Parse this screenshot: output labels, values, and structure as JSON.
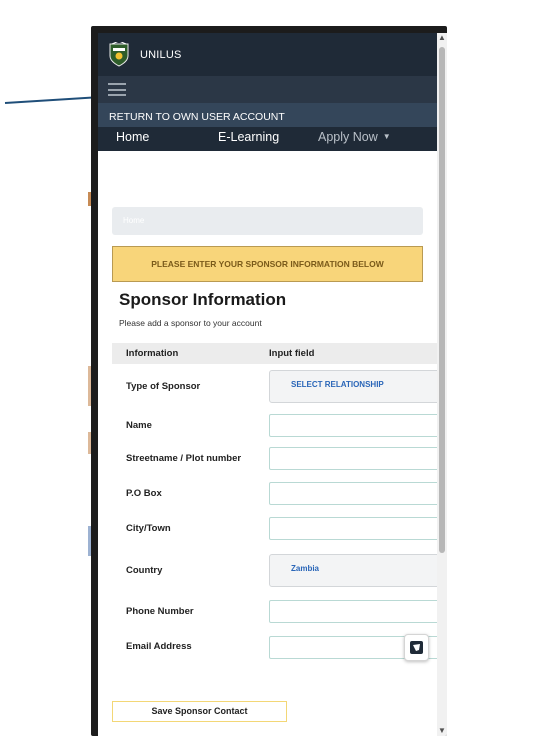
{
  "app": {
    "name": "UNILUS"
  },
  "nav": {
    "return_label": "RETURN TO OWN USER ACCOUNT",
    "links": [
      "Home",
      "E-Learning",
      "Apply Now"
    ]
  },
  "breadcrumb": "Home",
  "alert": "PLEASE ENTER YOUR SPONSOR INFORMATION BELOW",
  "form": {
    "title": "Sponsor Information",
    "subtitle": "Please add a sponsor to your account",
    "headers": [
      "Information",
      "Input field"
    ],
    "rows": {
      "sponsor_type": {
        "label": "Type of Sponsor",
        "value": "SELECT RELATIONSHIP"
      },
      "name": {
        "label": "Name",
        "value": ""
      },
      "street": {
        "label": "Streetname / Plot number",
        "value": ""
      },
      "po_box": {
        "label": "P.O Box",
        "value": ""
      },
      "city": {
        "label": "City/Town",
        "value": ""
      },
      "country": {
        "label": "Country",
        "value": "Zambia"
      },
      "phone": {
        "label": "Phone Number",
        "value": ""
      },
      "email": {
        "label": "Email Address",
        "value": ""
      }
    },
    "save_label": "Save Sponsor Contact"
  },
  "icons": {
    "menu": "hamburger-menu-icon",
    "logo": "university-crest-logo",
    "widget": "chat-widget-icon"
  },
  "colors": {
    "header_dark": "#1f2a37",
    "return_bar": "#34465a",
    "alert_bg": "#f8d57a",
    "select_text": "#2a66b8",
    "input_border": "#b9d9d4"
  }
}
